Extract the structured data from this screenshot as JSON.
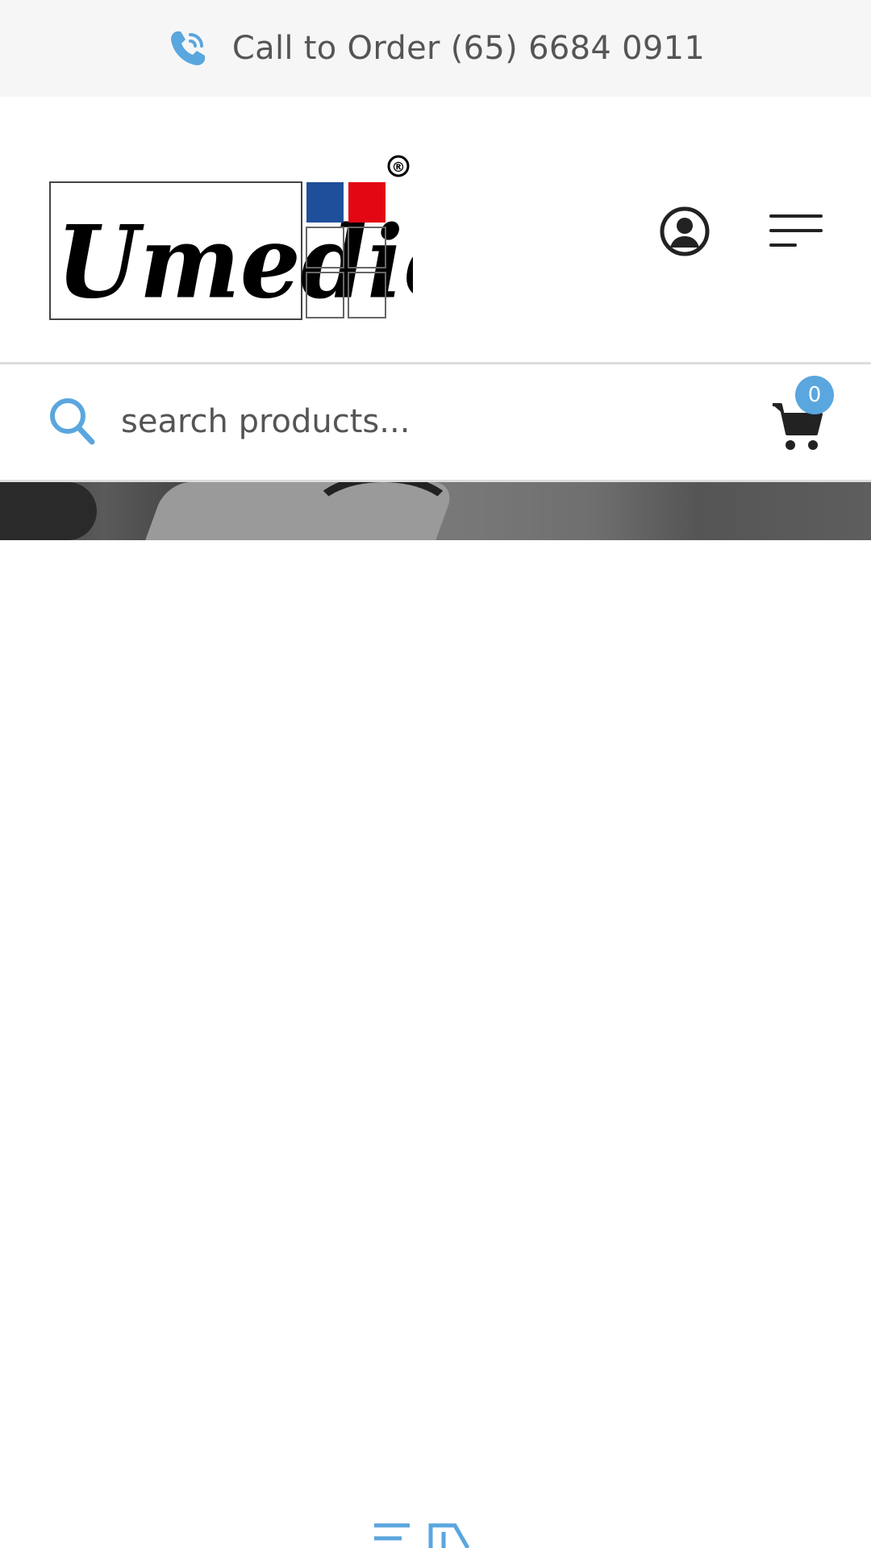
{
  "topbar": {
    "phone_icon": "phone-call-icon",
    "call_text": "Call to Order (65) 6684 0911"
  },
  "header": {
    "logo_text": "Umedic",
    "logo_mark": "®",
    "account_icon": "user-circle-icon",
    "menu_icon": "hamburger-menu-icon"
  },
  "search": {
    "placeholder": "search products...",
    "icon": "search-icon"
  },
  "cart": {
    "icon": "shopping-cart-icon",
    "count": "0"
  },
  "colors": {
    "accent": "#5aa6de",
    "topbar_bg": "#f6f6f6",
    "text": "#555555",
    "logo_blue": "#1f4f9a",
    "logo_red": "#e30613"
  }
}
